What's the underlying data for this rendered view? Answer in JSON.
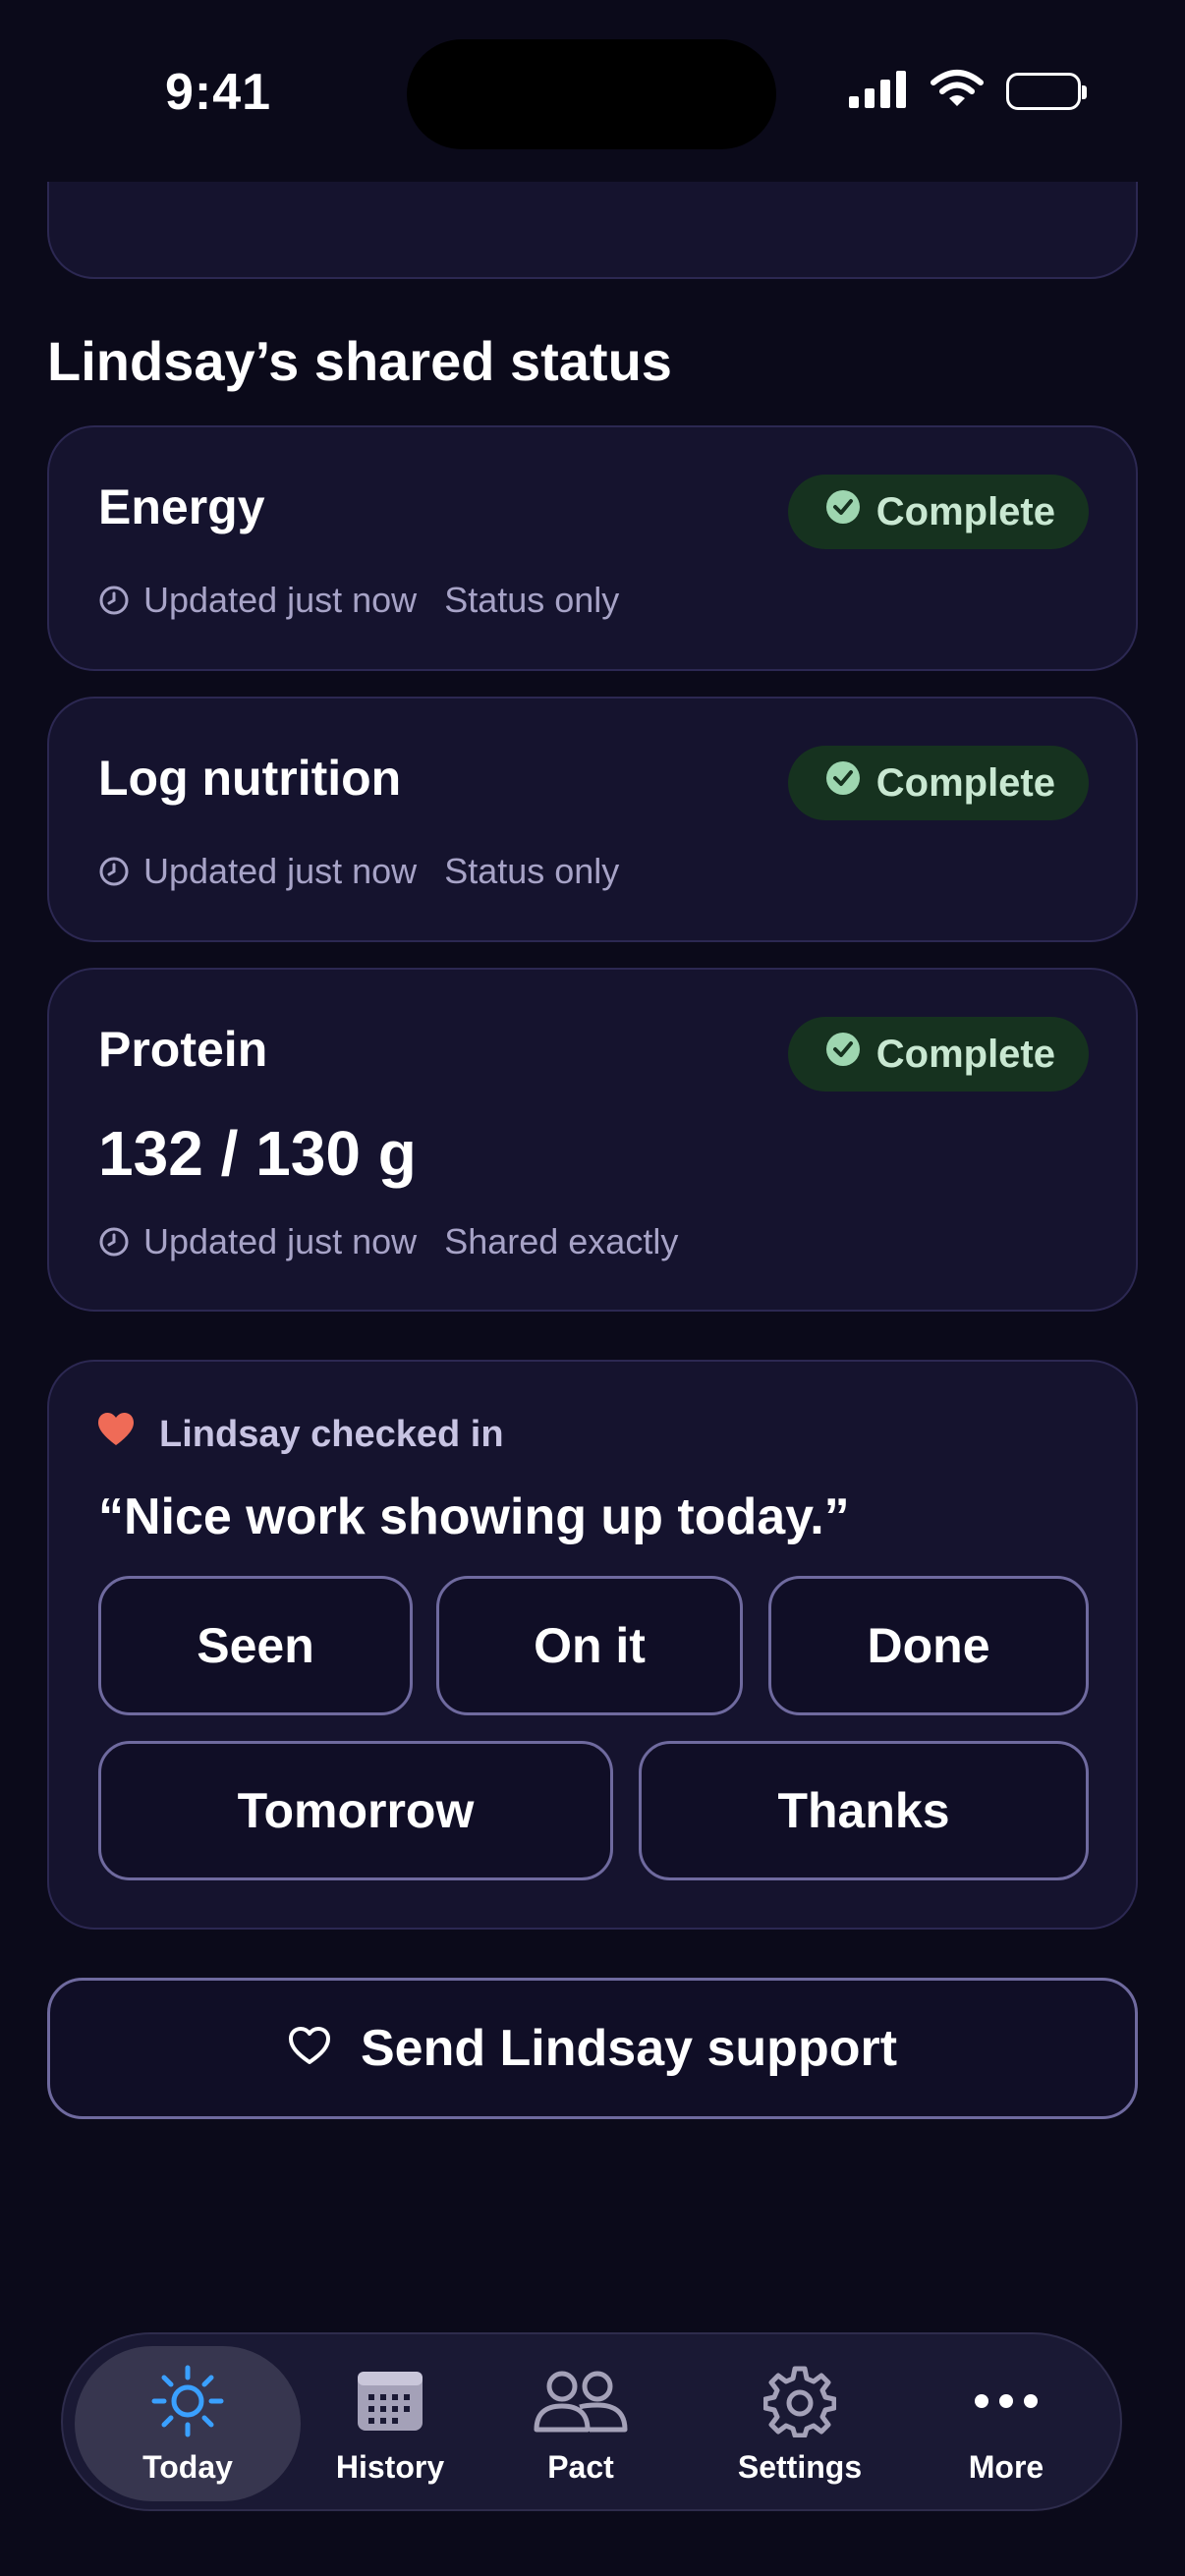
{
  "status_bar": {
    "time": "9:41"
  },
  "section": {
    "title": "Lindsay’s shared status"
  },
  "statuses": [
    {
      "name": "Energy",
      "badge": "Complete",
      "updated": "Updated just now",
      "sharing": "Status only"
    },
    {
      "name": "Log nutrition",
      "badge": "Complete",
      "updated": "Updated just now",
      "sharing": "Status only"
    },
    {
      "name": "Protein",
      "badge": "Complete",
      "amount": "132 / 130 g",
      "updated": "Updated just now",
      "sharing": "Shared exactly"
    }
  ],
  "checkin": {
    "header": "Lindsay checked in",
    "message": "“Nice work showing up today.”",
    "replies": [
      "Seen",
      "On it",
      "Done",
      "Tomorrow",
      "Thanks"
    ]
  },
  "support_button": {
    "label": "Send Lindsay support"
  },
  "tabs": [
    {
      "label": "Today",
      "icon": "sun-icon",
      "active": true
    },
    {
      "label": "History",
      "icon": "calendar-icon"
    },
    {
      "label": "Pact",
      "icon": "people-icon"
    },
    {
      "label": "Settings",
      "icon": "gear-icon"
    },
    {
      "label": "More",
      "icon": "more-dots-icon"
    }
  ],
  "colors": {
    "background": "#0b0a1a",
    "card": "#15132e",
    "accent": "#3aa0ff",
    "complete_badge": "#16321f",
    "heart": "#ef6b57"
  }
}
